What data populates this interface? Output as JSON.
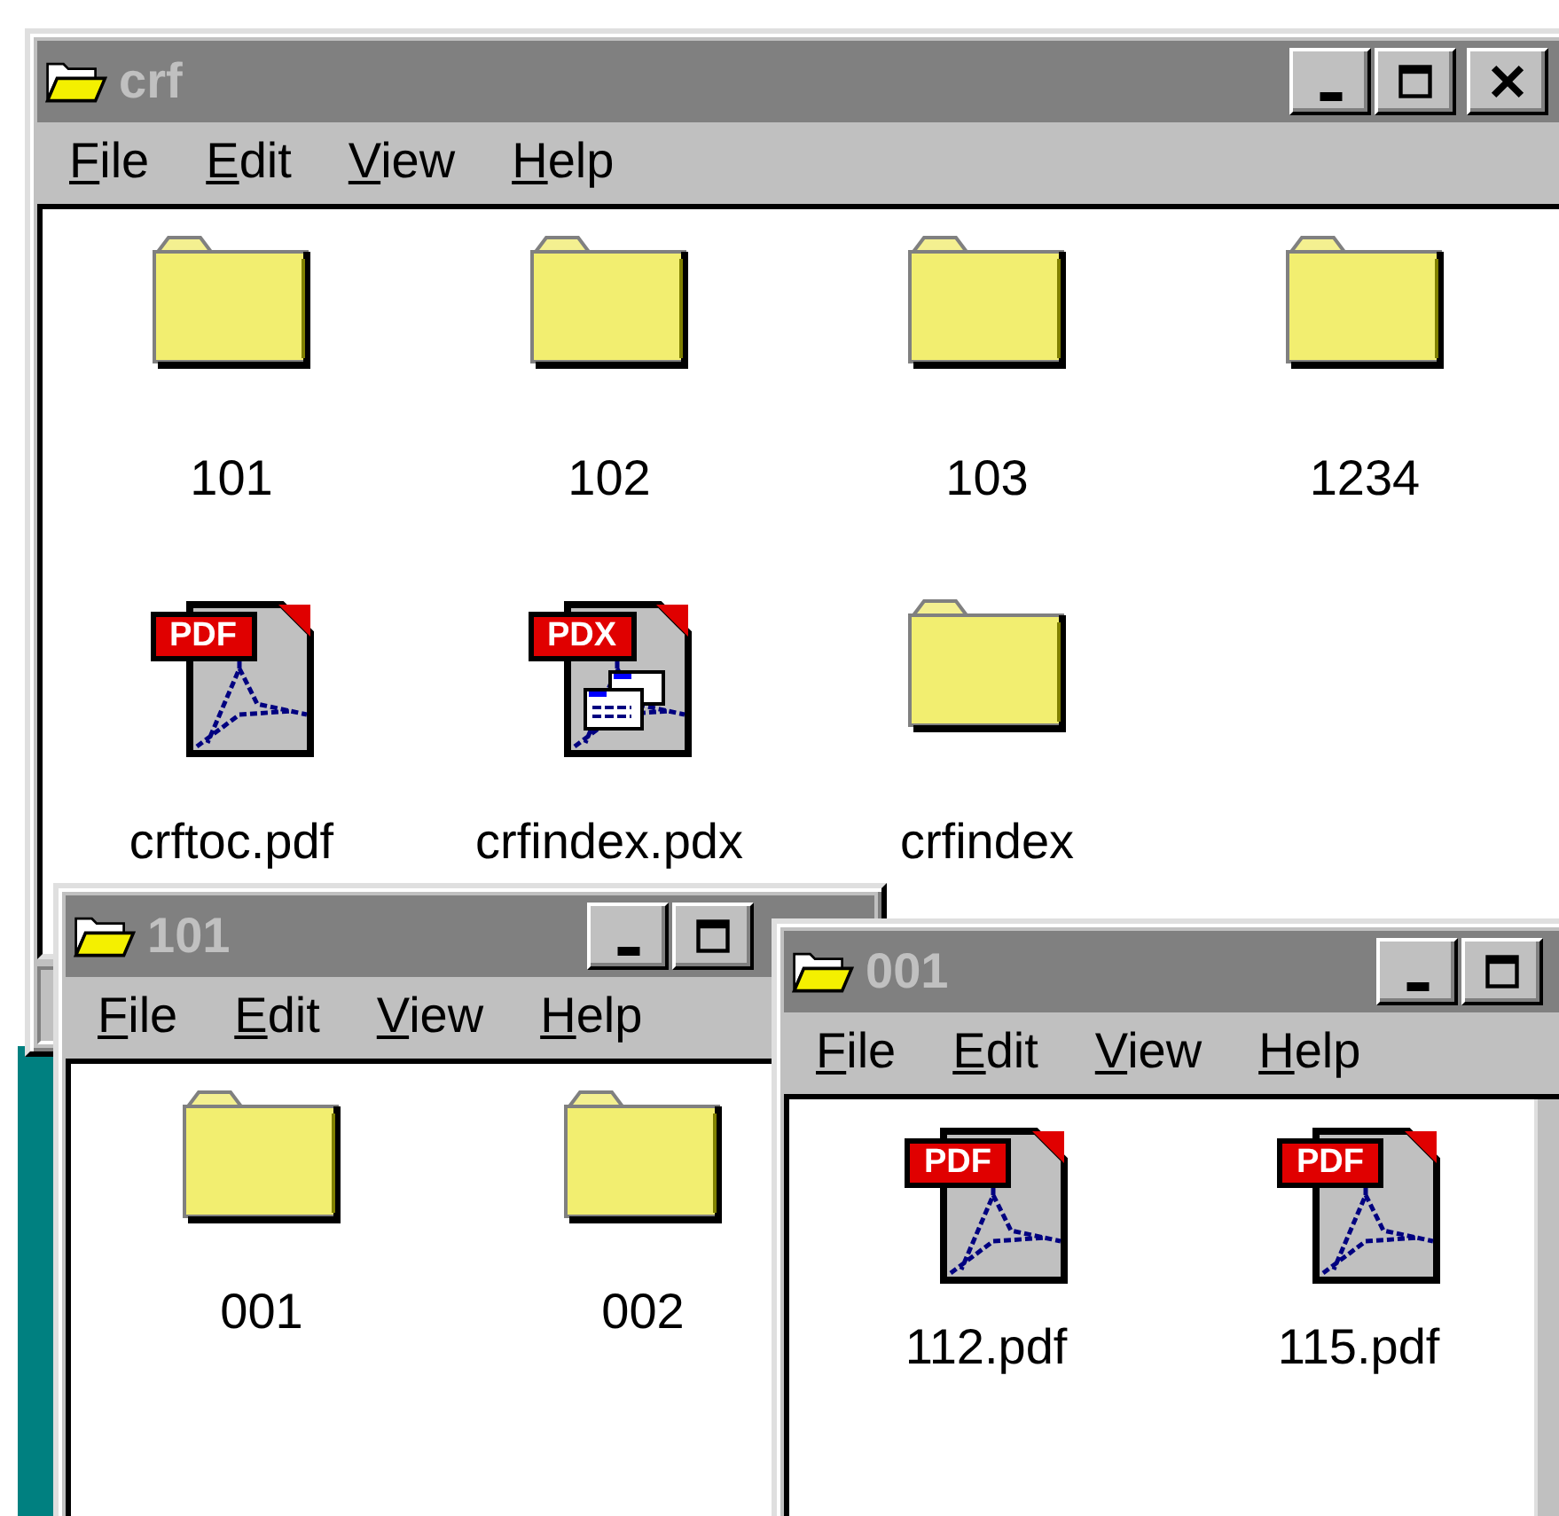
{
  "windows": [
    {
      "title": "crf",
      "buttons": [
        {
          "kind": "minimize"
        },
        {
          "kind": "maximize"
        },
        {
          "kind": "close"
        }
      ],
      "menu": [
        "File",
        "Edit",
        "View",
        "Help"
      ],
      "items": [
        {
          "name": "101",
          "kind": "folder"
        },
        {
          "name": "102",
          "kind": "folder"
        },
        {
          "name": "103",
          "kind": "folder"
        },
        {
          "name": "1234",
          "kind": "folder"
        },
        {
          "name": "crftoc.pdf",
          "kind": "pdf",
          "badge": "PDF"
        },
        {
          "name": "crfindex.pdx",
          "kind": "pdx",
          "badge": "PDX"
        },
        {
          "name": "crfindex",
          "kind": "folder"
        }
      ]
    },
    {
      "title": "101",
      "buttons": [
        {
          "kind": "minimize"
        },
        {
          "kind": "maximize"
        }
      ],
      "menu": [
        "File",
        "Edit",
        "View",
        "Help"
      ],
      "items": [
        {
          "name": "001",
          "kind": "folder"
        },
        {
          "name": "002",
          "kind": "folder"
        }
      ]
    },
    {
      "title": "001",
      "buttons": [
        {
          "kind": "minimize"
        },
        {
          "kind": "maximize"
        }
      ],
      "menu": [
        "File",
        "Edit",
        "View",
        "Help"
      ],
      "items": [
        {
          "name": "112.pdf",
          "kind": "pdf",
          "badge": "PDF"
        },
        {
          "name": "115.pdf",
          "kind": "pdf",
          "badge": "PDF"
        }
      ]
    }
  ]
}
